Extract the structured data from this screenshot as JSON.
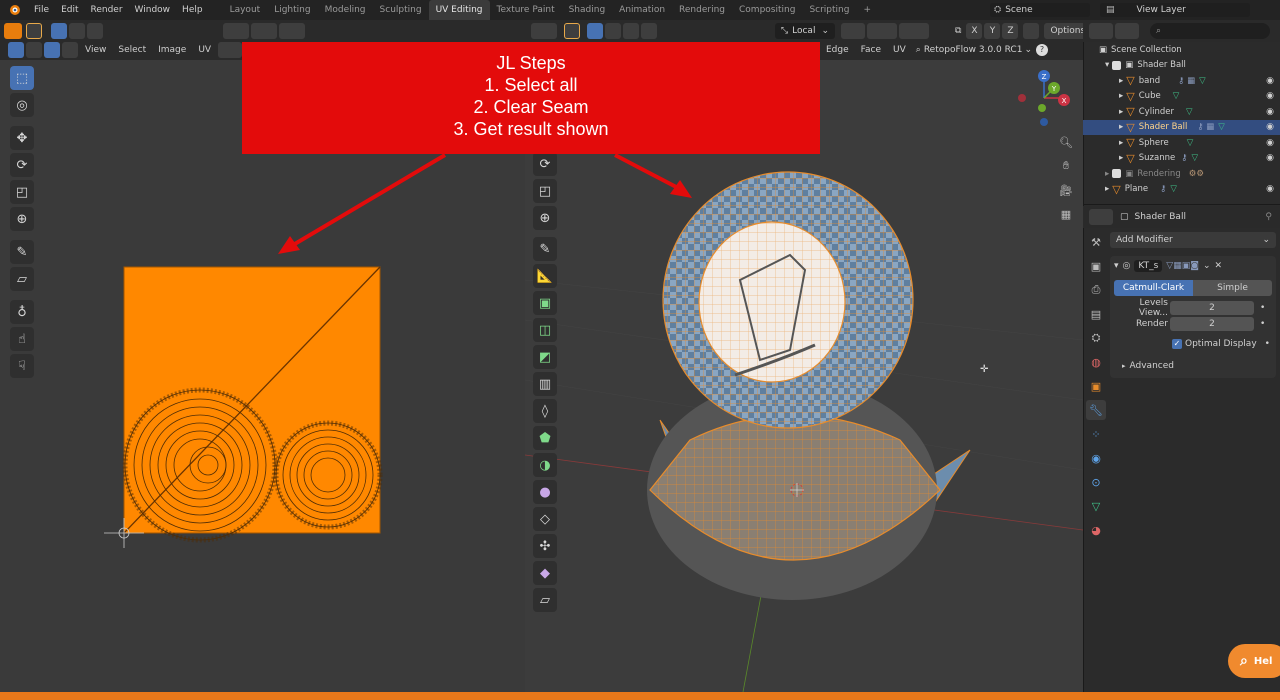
{
  "topbar": {
    "menus": [
      "File",
      "Edit",
      "Render",
      "Window",
      "Help"
    ],
    "workspaces": [
      "Layout",
      "Lighting",
      "Modeling",
      "Sculpting",
      "UV Editing",
      "Texture Paint",
      "Shading",
      "Animation",
      "Rendering",
      "Compositing",
      "Scripting"
    ],
    "active_workspace": "UV Editing",
    "add_tab": "+",
    "scene_label": "Scene",
    "view_layer_label": "View Layer"
  },
  "uv_editor": {
    "menus": [
      "View",
      "Select",
      "Image",
      "UV"
    ]
  },
  "viewport": {
    "orientation": "Local",
    "axis_labels": [
      "X",
      "Y",
      "Z"
    ],
    "options_label": "Options",
    "menus": [
      "Edge",
      "Face",
      "UV"
    ],
    "addon_label": "RetopoFlow 3.0.0 RC1",
    "gizmo_axes": [
      "Z",
      "Y",
      "X"
    ]
  },
  "annotation": {
    "title": "JL Steps",
    "steps": [
      "1. Select all",
      "2. Clear Seam",
      "3. Get result shown"
    ],
    "color": "#e30b0b"
  },
  "outliner": {
    "root": "Scene Collection",
    "collection": "Shader Ball",
    "items": [
      {
        "name": "band",
        "selected": false
      },
      {
        "name": "Cube",
        "selected": false
      },
      {
        "name": "Cylinder",
        "selected": false
      },
      {
        "name": "Shader Ball",
        "selected": true
      },
      {
        "name": "Sphere",
        "selected": false
      },
      {
        "name": "Suzanne",
        "selected": false
      }
    ],
    "rendering": "Rendering",
    "plane": "Plane"
  },
  "properties": {
    "object_name": "Shader Ball",
    "add_modifier": "Add Modifier",
    "modifier_name": "KT_s",
    "tab_catmull": "Catmull-Clark",
    "tab_simple": "Simple",
    "levels_viewport_label": "Levels View...",
    "levels_viewport_value": "2",
    "render_label": "Render",
    "render_value": "2",
    "optimal_display_label": "Optimal Display",
    "optimal_display_checked": true,
    "advanced_label": "Advanced"
  },
  "help_button": {
    "label": "Hel"
  },
  "colors": {
    "accent_blue": "#4772b3",
    "uv_orange": "#ff8800",
    "mesh_orange": "#e88c2b",
    "bottom_bar": "#e8781a"
  }
}
